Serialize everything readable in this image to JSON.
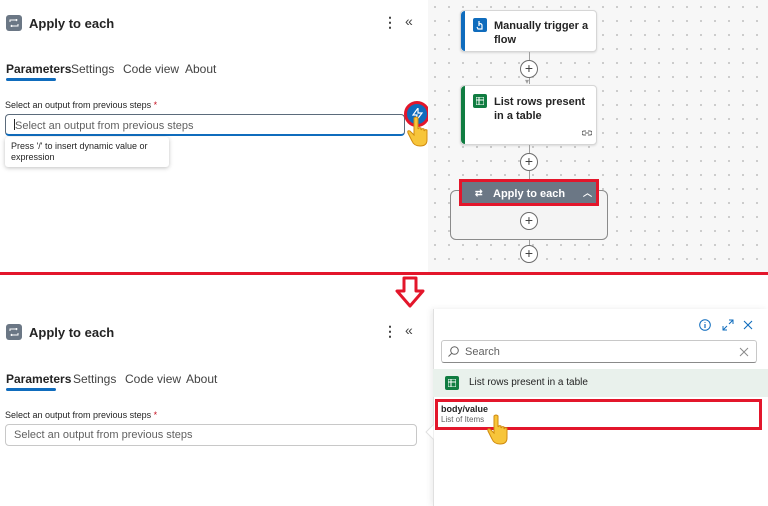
{
  "top": {
    "panel": {
      "title": "Apply to each",
      "tabs": [
        "Parameters",
        "Settings",
        "Code view",
        "About"
      ],
      "field_label": "Select an output from previous steps",
      "required_marker": "*",
      "input_placeholder": "Select an output from previous steps",
      "tooltip": "Press '/' to insert dynamic value or expression"
    },
    "canvas": {
      "trigger_card": "Manually trigger a flow",
      "list_card": "List rows present in a table",
      "loop_card": "Apply to each",
      "accent_trigger": "#0f6cbd",
      "accent_excel": "#107c41"
    }
  },
  "bottom": {
    "panel": {
      "title": "Apply to each",
      "tabs": [
        "Parameters",
        "Settings",
        "Code view",
        "About"
      ],
      "field_label": "Select an output from previous steps",
      "required_marker": "*",
      "input_placeholder": "Select an output from previous steps"
    },
    "popup": {
      "search_placeholder": "Search",
      "section_title": "List rows present in a table",
      "item_name": "body/value",
      "item_desc": "List of Items"
    }
  },
  "colors": {
    "highlight": "#e3162b",
    "accent": "#0f6cbd",
    "excel": "#107c41",
    "loop": "#6b7785"
  },
  "icons": [
    "loop-icon",
    "more-icon",
    "collapse-icon",
    "dynamic-content-icon",
    "pointer-hand-icon",
    "excel-icon",
    "trigger-icon",
    "link-icon",
    "plus-icon",
    "down-arrow-icon",
    "info-icon",
    "expand-icon",
    "close-icon",
    "search-icon",
    "clear-icon"
  ]
}
